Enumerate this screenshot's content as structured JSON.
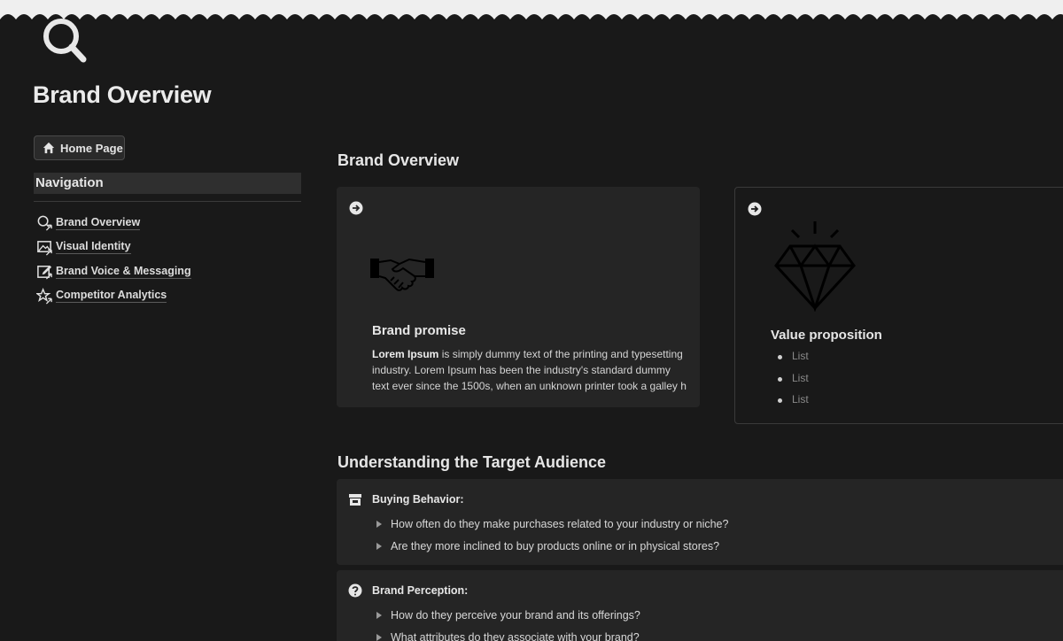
{
  "page": {
    "title": "Brand Overview"
  },
  "sidebar": {
    "home_button": "Home Page",
    "nav_heading": "Navigation",
    "items": [
      {
        "label": "Brand Overview",
        "icon": "search-user-icon"
      },
      {
        "label": "Visual Identity",
        "icon": "image-icon"
      },
      {
        "label": "Brand Voice & Messaging",
        "icon": "edit-icon"
      },
      {
        "label": "Competitor Analytics",
        "icon": "stars-icon"
      }
    ]
  },
  "main": {
    "section_heading": "Brand Overview",
    "promise_card": {
      "icon": "handshake-icon",
      "title": "Brand promise",
      "text_bold": "Lorem Ipsum",
      "text_rest": " is simply dummy text of the printing and typesetting industry. Lorem Ipsum has been the industry's standard dummy text ever since the 1500s, when an unknown printer took a galley h"
    },
    "value_card": {
      "icon": "diamond-icon",
      "title": "Value proposition",
      "items": [
        "List",
        "List",
        "List"
      ]
    },
    "audience_heading": "Understanding the Target Audience",
    "callouts": [
      {
        "icon": "store-icon",
        "title": "Buying Behavior:",
        "items": [
          "How often do they make purchases related to your industry or niche?",
          "Are they more inclined to buy products online or in physical stores?"
        ]
      },
      {
        "icon": "question-icon",
        "title": "Brand Perception:",
        "items": [
          "How do they perceive your brand and its offerings?",
          "What attributes do they associate with your brand?"
        ]
      }
    ]
  },
  "colors": {
    "background": "#191919",
    "card": "#252525",
    "text": "#e6e6e6",
    "muted": "#8a8a8a"
  }
}
